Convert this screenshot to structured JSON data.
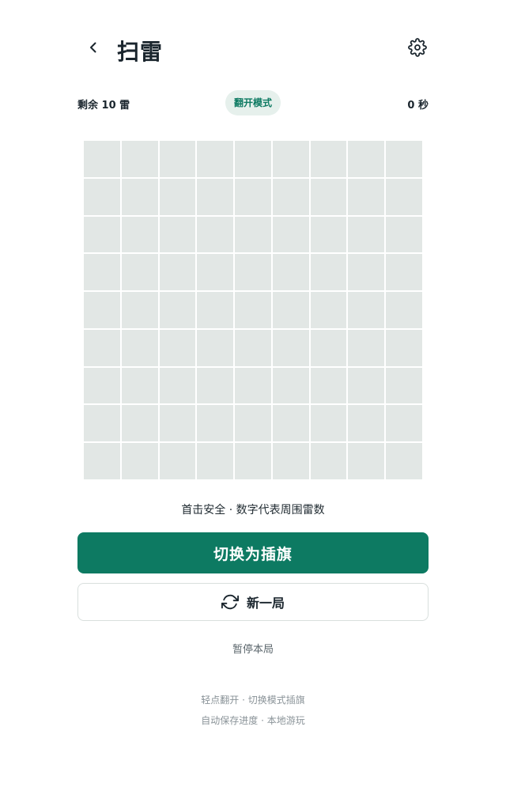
{
  "header": {
    "back_icon": "chevron-left-icon",
    "title": "扫雷",
    "settings_icon": "gear-icon"
  },
  "status": {
    "mines_remaining": "剩余 10 雷",
    "mode": "翻开模式",
    "timer": "0 秒"
  },
  "board": {
    "rows": 9,
    "cols": 9,
    "cell_state": "unrevealed"
  },
  "hint": "首击安全 · 数字代表周围雷数",
  "actions": {
    "toggle_mode_label": "切换为插旗",
    "new_game_label": "新一局",
    "new_game_icon": "refresh-icon",
    "pause_label": "暂停本局"
  },
  "footer": {
    "line1": "轻点翻开 · 切换模式插旗",
    "line2": "自动保存进度 · 本地游玩"
  },
  "colors": {
    "accent": "#0d7a62",
    "badge_bg": "#e6f0ec",
    "cell": "#e2e7e5"
  }
}
